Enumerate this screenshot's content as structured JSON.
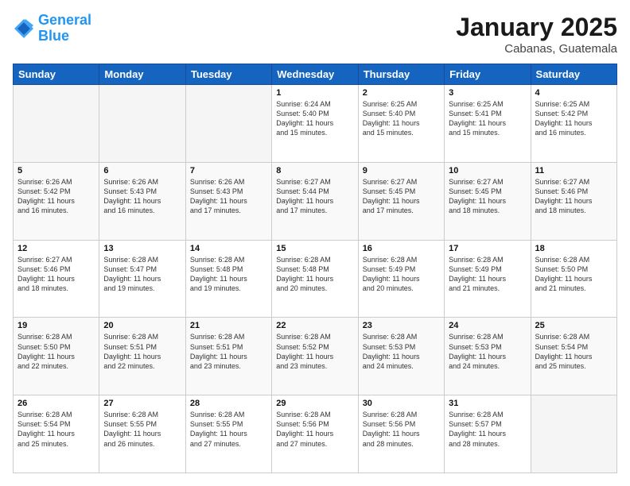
{
  "header": {
    "logo_line1": "General",
    "logo_line2": "Blue",
    "month": "January 2025",
    "location": "Cabanas, Guatemala"
  },
  "weekdays": [
    "Sunday",
    "Monday",
    "Tuesday",
    "Wednesday",
    "Thursday",
    "Friday",
    "Saturday"
  ],
  "weeks": [
    [
      {
        "day": "",
        "info": ""
      },
      {
        "day": "",
        "info": ""
      },
      {
        "day": "",
        "info": ""
      },
      {
        "day": "1",
        "info": "Sunrise: 6:24 AM\nSunset: 5:40 PM\nDaylight: 11 hours\nand 15 minutes."
      },
      {
        "day": "2",
        "info": "Sunrise: 6:25 AM\nSunset: 5:40 PM\nDaylight: 11 hours\nand 15 minutes."
      },
      {
        "day": "3",
        "info": "Sunrise: 6:25 AM\nSunset: 5:41 PM\nDaylight: 11 hours\nand 15 minutes."
      },
      {
        "day": "4",
        "info": "Sunrise: 6:25 AM\nSunset: 5:42 PM\nDaylight: 11 hours\nand 16 minutes."
      }
    ],
    [
      {
        "day": "5",
        "info": "Sunrise: 6:26 AM\nSunset: 5:42 PM\nDaylight: 11 hours\nand 16 minutes."
      },
      {
        "day": "6",
        "info": "Sunrise: 6:26 AM\nSunset: 5:43 PM\nDaylight: 11 hours\nand 16 minutes."
      },
      {
        "day": "7",
        "info": "Sunrise: 6:26 AM\nSunset: 5:43 PM\nDaylight: 11 hours\nand 17 minutes."
      },
      {
        "day": "8",
        "info": "Sunrise: 6:27 AM\nSunset: 5:44 PM\nDaylight: 11 hours\nand 17 minutes."
      },
      {
        "day": "9",
        "info": "Sunrise: 6:27 AM\nSunset: 5:45 PM\nDaylight: 11 hours\nand 17 minutes."
      },
      {
        "day": "10",
        "info": "Sunrise: 6:27 AM\nSunset: 5:45 PM\nDaylight: 11 hours\nand 18 minutes."
      },
      {
        "day": "11",
        "info": "Sunrise: 6:27 AM\nSunset: 5:46 PM\nDaylight: 11 hours\nand 18 minutes."
      }
    ],
    [
      {
        "day": "12",
        "info": "Sunrise: 6:27 AM\nSunset: 5:46 PM\nDaylight: 11 hours\nand 18 minutes."
      },
      {
        "day": "13",
        "info": "Sunrise: 6:28 AM\nSunset: 5:47 PM\nDaylight: 11 hours\nand 19 minutes."
      },
      {
        "day": "14",
        "info": "Sunrise: 6:28 AM\nSunset: 5:48 PM\nDaylight: 11 hours\nand 19 minutes."
      },
      {
        "day": "15",
        "info": "Sunrise: 6:28 AM\nSunset: 5:48 PM\nDaylight: 11 hours\nand 20 minutes."
      },
      {
        "day": "16",
        "info": "Sunrise: 6:28 AM\nSunset: 5:49 PM\nDaylight: 11 hours\nand 20 minutes."
      },
      {
        "day": "17",
        "info": "Sunrise: 6:28 AM\nSunset: 5:49 PM\nDaylight: 11 hours\nand 21 minutes."
      },
      {
        "day": "18",
        "info": "Sunrise: 6:28 AM\nSunset: 5:50 PM\nDaylight: 11 hours\nand 21 minutes."
      }
    ],
    [
      {
        "day": "19",
        "info": "Sunrise: 6:28 AM\nSunset: 5:50 PM\nDaylight: 11 hours\nand 22 minutes."
      },
      {
        "day": "20",
        "info": "Sunrise: 6:28 AM\nSunset: 5:51 PM\nDaylight: 11 hours\nand 22 minutes."
      },
      {
        "day": "21",
        "info": "Sunrise: 6:28 AM\nSunset: 5:51 PM\nDaylight: 11 hours\nand 23 minutes."
      },
      {
        "day": "22",
        "info": "Sunrise: 6:28 AM\nSunset: 5:52 PM\nDaylight: 11 hours\nand 23 minutes."
      },
      {
        "day": "23",
        "info": "Sunrise: 6:28 AM\nSunset: 5:53 PM\nDaylight: 11 hours\nand 24 minutes."
      },
      {
        "day": "24",
        "info": "Sunrise: 6:28 AM\nSunset: 5:53 PM\nDaylight: 11 hours\nand 24 minutes."
      },
      {
        "day": "25",
        "info": "Sunrise: 6:28 AM\nSunset: 5:54 PM\nDaylight: 11 hours\nand 25 minutes."
      }
    ],
    [
      {
        "day": "26",
        "info": "Sunrise: 6:28 AM\nSunset: 5:54 PM\nDaylight: 11 hours\nand 25 minutes."
      },
      {
        "day": "27",
        "info": "Sunrise: 6:28 AM\nSunset: 5:55 PM\nDaylight: 11 hours\nand 26 minutes."
      },
      {
        "day": "28",
        "info": "Sunrise: 6:28 AM\nSunset: 5:55 PM\nDaylight: 11 hours\nand 27 minutes."
      },
      {
        "day": "29",
        "info": "Sunrise: 6:28 AM\nSunset: 5:56 PM\nDaylight: 11 hours\nand 27 minutes."
      },
      {
        "day": "30",
        "info": "Sunrise: 6:28 AM\nSunset: 5:56 PM\nDaylight: 11 hours\nand 28 minutes."
      },
      {
        "day": "31",
        "info": "Sunrise: 6:28 AM\nSunset: 5:57 PM\nDaylight: 11 hours\nand 28 minutes."
      },
      {
        "day": "",
        "info": ""
      }
    ]
  ]
}
